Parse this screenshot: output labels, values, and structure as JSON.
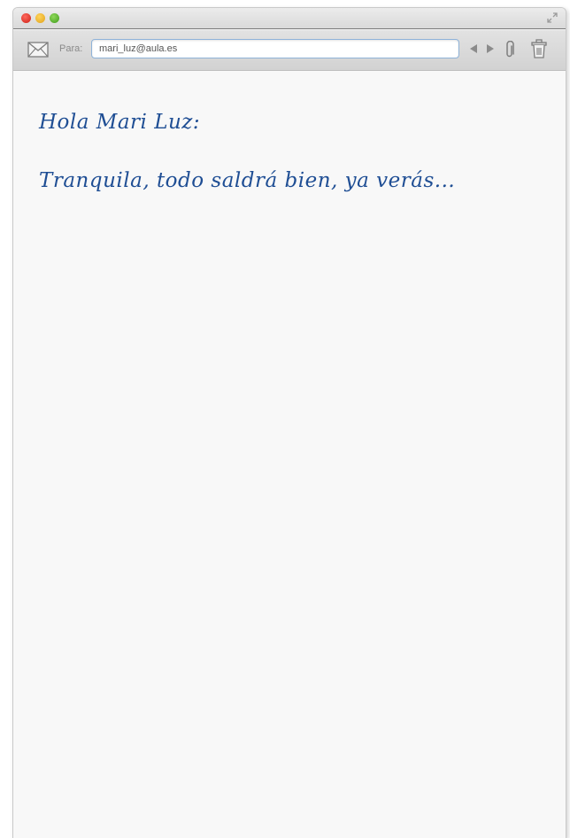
{
  "window": {
    "traffic_lights": [
      "close",
      "minimize",
      "zoom"
    ]
  },
  "toolbar": {
    "to_label": "Para:",
    "to_value": "mari_luz@aula.es",
    "icons": [
      "mail-icon",
      "previous-icon",
      "next-icon",
      "paperclip-icon",
      "trash-icon"
    ]
  },
  "message": {
    "greeting": "Hola Mari Luz:",
    "body": "Tranquila, todo saldrá bien, ya verás..."
  },
  "colors": {
    "handwriting": "#1f4e94",
    "close": "#e0332a",
    "minimize": "#f0b93a",
    "zoom": "#6cbf3a"
  }
}
